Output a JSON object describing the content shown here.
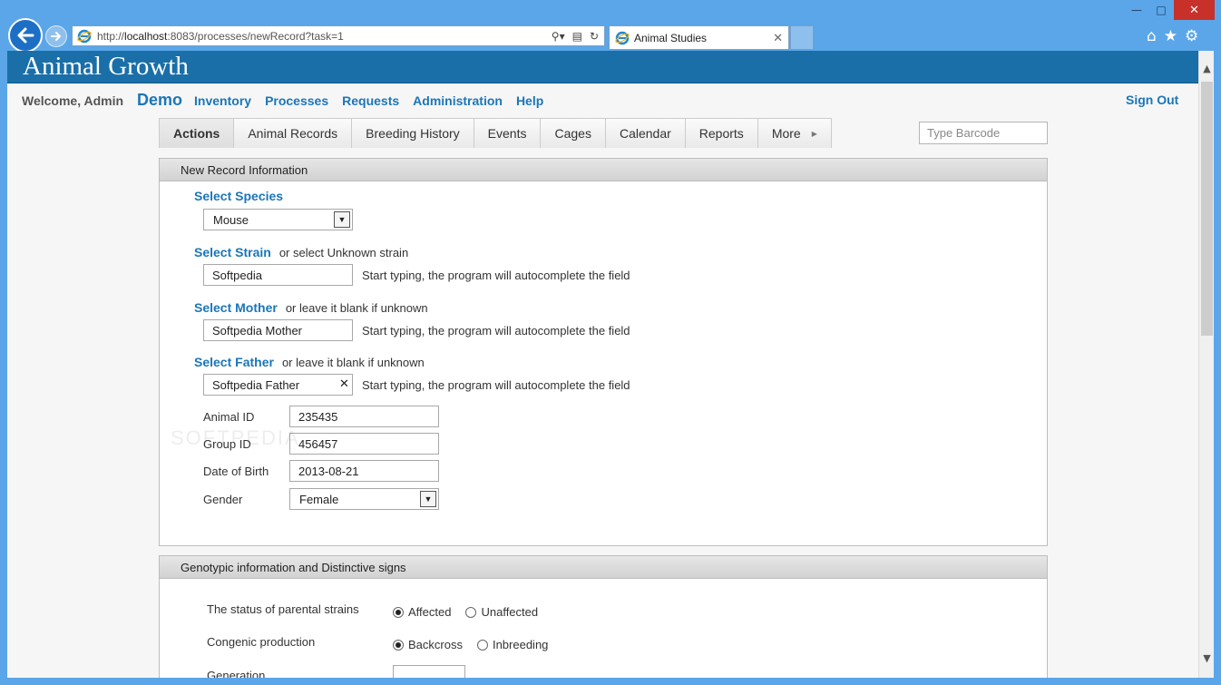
{
  "browser": {
    "url_prefix": "http://",
    "url_host": "localhost",
    "url_rest": ":8083/processes/newRecord?task=1",
    "tab_title": "Animal Studies",
    "tab_close": "✕",
    "window_controls": {
      "minimize": "—",
      "maximize": "□",
      "close": "✕"
    },
    "toolbar_icons": [
      "home-icon",
      "favorites-star-icon",
      "settings-gear-icon"
    ]
  },
  "app": {
    "title": "Animal Growth",
    "welcome": "Welcome, Admin",
    "nav": {
      "demo": "Demo",
      "links": [
        "Inventory",
        "Processes",
        "Requests",
        "Administration",
        "Help"
      ]
    },
    "sign_out": "Sign Out"
  },
  "tabs": [
    "Actions",
    "Animal Records",
    "Breeding History",
    "Events",
    "Cages",
    "Calendar",
    "Reports",
    "More"
  ],
  "barcode": {
    "placeholder": "Type Barcode"
  },
  "new_record": {
    "heading": "New Record Information",
    "species": {
      "label": "Select Species",
      "value": "Mouse"
    },
    "strain": {
      "label": "Select Strain",
      "note": "or select Unknown strain",
      "value": "Softpedia",
      "hint": "Start typing, the program will autocomplete the field"
    },
    "mother": {
      "label": "Select Mother",
      "note": "or leave it blank if unknown",
      "value": "Softpedia Mother",
      "hint": "Start typing, the program will autocomplete the field"
    },
    "father": {
      "label": "Select Father",
      "note": "or leave it blank if unknown",
      "value": "Softpedia Father",
      "hint": "Start typing, the program will autocomplete the field",
      "clear": "✕"
    },
    "animal_id": {
      "label": "Animal ID",
      "value": "235435"
    },
    "group_id": {
      "label": "Group ID",
      "value": "456457"
    },
    "dob": {
      "label": "Date of Birth",
      "value": "2013-08-21"
    },
    "gender": {
      "label": "Gender",
      "value": "Female"
    }
  },
  "genotypic": {
    "heading": "Genotypic information and Distinctive signs",
    "parental": {
      "label": "The status of parental strains",
      "options": [
        "Affected",
        "Unaffected"
      ],
      "selected": "Affected"
    },
    "congenic": {
      "label": "Congenic production",
      "options": [
        "Backcross",
        "Inbreeding"
      ],
      "selected": "Backcross"
    },
    "generation": {
      "label": "Generation",
      "value": ""
    }
  },
  "watermark": "SOFTPEDIA",
  "colors": {
    "header_blue": "#1b6fa8",
    "link_blue": "#1b76b8",
    "chrome_blue": "#5aa6e8",
    "close_red": "#c7312a"
  }
}
